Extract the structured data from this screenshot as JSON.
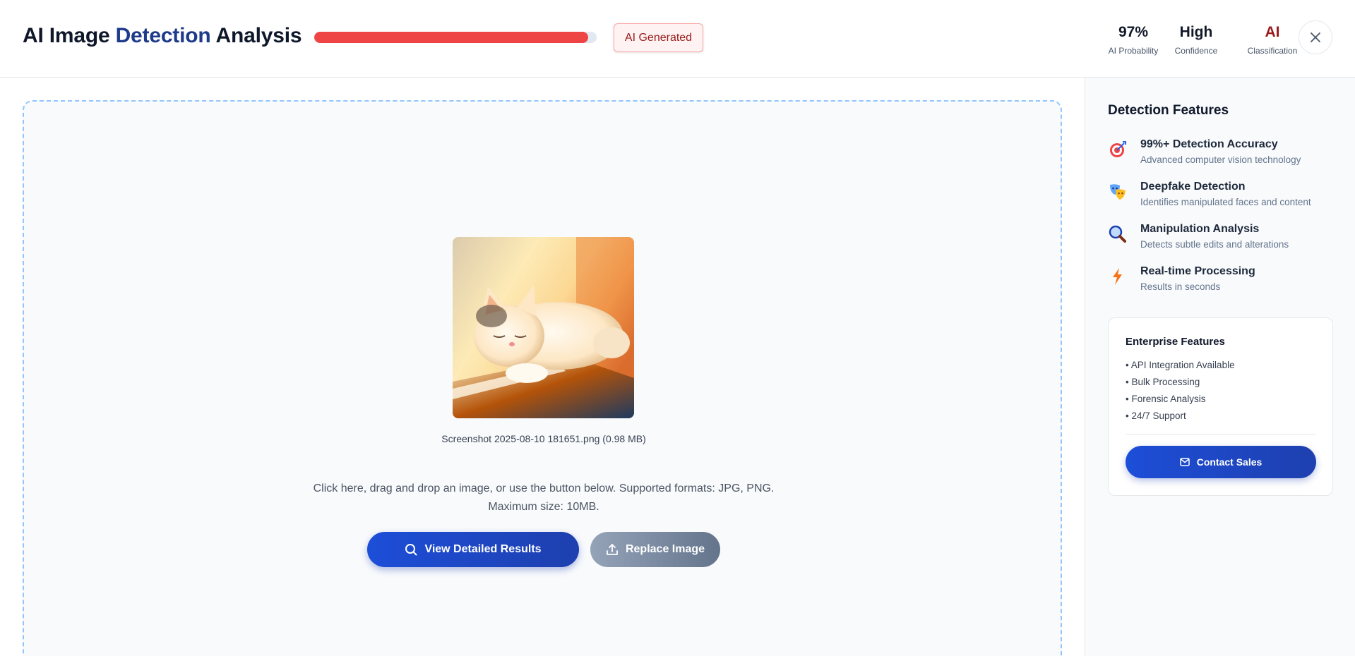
{
  "header": {
    "title_prefix": "AI Image",
    "title_accent": "Detection",
    "title_suffix": "Analysis",
    "ai_probability_fill": 0.97,
    "badge": "AI Generated",
    "stats": [
      {
        "value": "97%",
        "label": "AI Probability"
      },
      {
        "value": "High",
        "label": "Confidence"
      },
      {
        "value": "AI",
        "label": "Classification"
      }
    ],
    "close_icon": "close-icon"
  },
  "main": {
    "image_icon": "cat-photo-thumbnail",
    "file_name": "Screenshot 2025-08-10 181651.png (0.98 MB)",
    "help_line1": "Click here, drag and drop an image, or use the button below. Supported formats: JPG, PNG.",
    "help_line2": "Maximum size: 10MB.",
    "primary_button": "View Detailed Results",
    "secondary_button": "Replace Image"
  },
  "sidebar": {
    "title": "Detection Features",
    "features": [
      {
        "icon": "target-icon",
        "title": "99%+ Detection Accuracy",
        "desc": "Advanced computer vision technology"
      },
      {
        "icon": "masks-icon",
        "title": "Deepfake Detection",
        "desc": "Identifies manipulated faces and content"
      },
      {
        "icon": "magnifier-icon",
        "title": "Manipulation Analysis",
        "desc": "Detects subtle edits and alterations"
      },
      {
        "icon": "lightning-icon",
        "title": "Real-time Processing",
        "desc": "Results in seconds"
      }
    ],
    "enterprise": {
      "title": "Enterprise Features",
      "items": [
        "• API Integration Available",
        "• Bulk Processing",
        "• Forensic Analysis",
        "• 24/7 Support"
      ],
      "button": "Contact Sales"
    }
  },
  "colors": {
    "accent": "#1e40af",
    "danger": "#ef4444",
    "badge_text": "#991b1b",
    "dashed_border": "#93c5fd"
  }
}
